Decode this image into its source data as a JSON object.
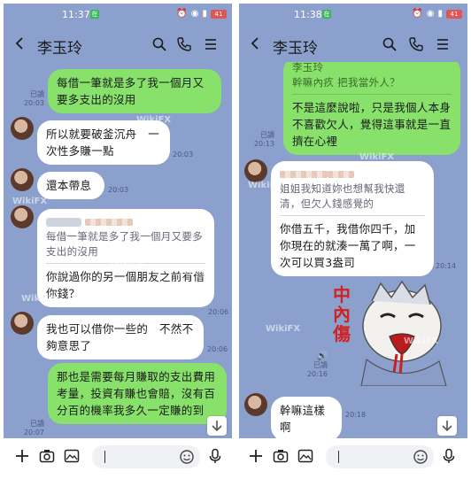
{
  "left": {
    "status_time": "11:37",
    "status_badge": "在",
    "battery": "41",
    "contact_name": "李玉玲",
    "messages": {
      "m1": "每借一筆就是多了我一個月又要多支出的沒用",
      "m1_read": "已讀",
      "m1_time": "20:03",
      "m2": "所以就要破釜沉舟　一次性多賺一點",
      "m2_time": "20:03",
      "m3": "還本帶息",
      "m3_time": "20:03",
      "m4_quote": "每借一筆就是多了我一個月又要多支出的沒用",
      "m4": "你說過你的另一個朋友之前有借你錢？",
      "m4_time": "20:06",
      "m5": "我也可以借你一些的　不然不夠意思了",
      "m5_time": "20:06",
      "m6": "那也是需要每月賺取的支出費用考量，投資有賺也會賠，沒有百分百的機率我多久一定賺的到",
      "m6_read": "已讀",
      "m6_time": "20:07"
    },
    "watermark": "WikiFX"
  },
  "right": {
    "status_time": "11:38",
    "status_badge": "在",
    "battery": "41",
    "contact_name": "李玉玲",
    "messages": {
      "r0_name": "李玉玲",
      "r0_quote": "幹嘛內疚 把我當外人？",
      "r0": "不是這麼說啦，只是我個人本身不喜歡欠人，覺得這事就是一直擠在心裡",
      "r0_read": "已讀",
      "r0_time": "20:13",
      "r1_quote": "姐姐我知道妳也想幫我快還清，但欠人錢感覺的",
      "r1": "你借五千，我借你四千，加你現在的就湊一萬了啊，一次可以買3盎司",
      "r1_time": "20:14",
      "sticker_text": "中內傷",
      "voice_read": "已讀",
      "voice_time": "20:16",
      "r2": "幹嘛這樣啊",
      "r2_time": "20:18"
    },
    "watermark": "WikiFX"
  },
  "icons": [
    "back-icon",
    "search-icon",
    "phone-icon",
    "menu-icon",
    "plus-icon",
    "camera-icon",
    "image-icon",
    "emoji-icon",
    "mic-icon",
    "scroll-down-icon"
  ],
  "colors": {
    "background": "#8ca0cd",
    "outgoing_bubble": "#87e16a",
    "incoming_bubble": "#ffffff"
  }
}
